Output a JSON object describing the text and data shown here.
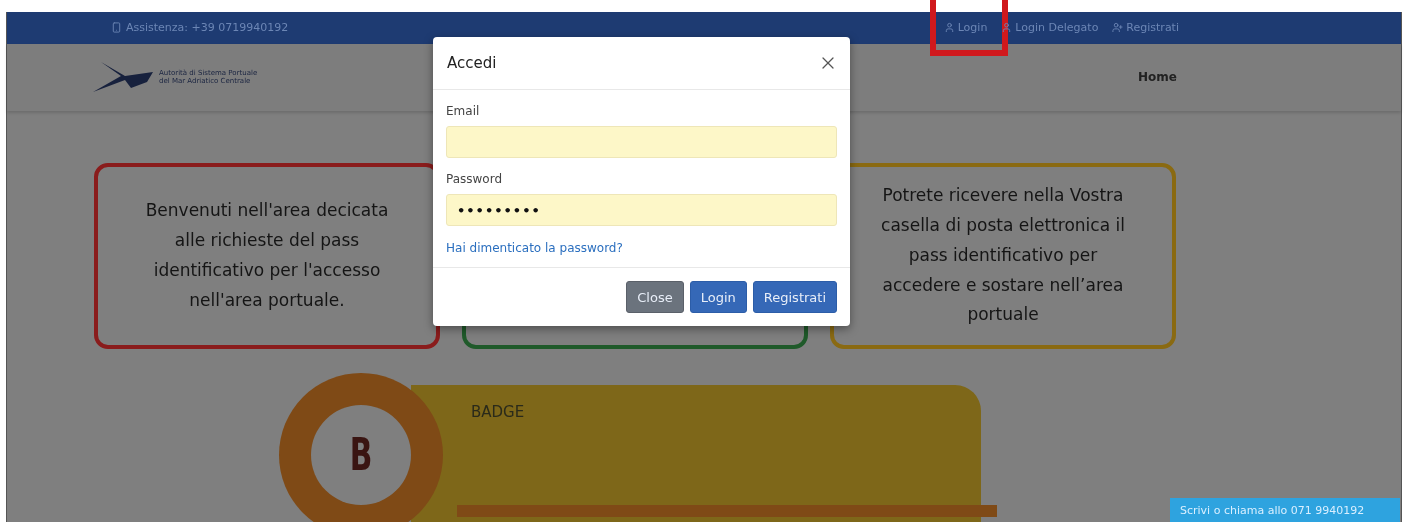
{
  "top_bar": {
    "assistance": "Assistenza: +39 0719940192",
    "links": [
      {
        "label": "Login",
        "highlighted": true
      },
      {
        "label": "Login Delegato",
        "highlighted": false
      },
      {
        "label": "Registrati",
        "highlighted": false
      }
    ]
  },
  "header": {
    "logo_text": [
      "Autorità di Sistema Portuale",
      "del Mar Adriatico Centrale"
    ],
    "nav": [
      "Home"
    ]
  },
  "cards": [
    {
      "text": "Benvenuti nell'area decicata alle richieste del pass identificativo per l'accesso nell'area portuale.",
      "color": "#8a1c1c"
    },
    {
      "color": "#1f5a2a"
    },
    {
      "text": "Potrete ricevere nella Vostra casella di posta elettronica il pass identificativo per accedere e sostare nell’area portuale",
      "color": "#8a6a12"
    }
  ],
  "badge": {
    "letter": "B",
    "title": "BADGE"
  },
  "modal": {
    "title": "Accedi",
    "fields": [
      {
        "label": "Email",
        "kind": "text"
      },
      {
        "label": "Password",
        "value": "•••••••••",
        "kind": "password"
      }
    ],
    "forgot_link": "Hai dimenticato la password?",
    "buttons": [
      {
        "label": "Close",
        "kind": "secondary"
      },
      {
        "label": "Login",
        "kind": "primary"
      },
      {
        "label": "Registrati",
        "kind": "primary"
      }
    ]
  },
  "chat": {
    "text": "Scrivi o chiama allo 071 9940192"
  }
}
